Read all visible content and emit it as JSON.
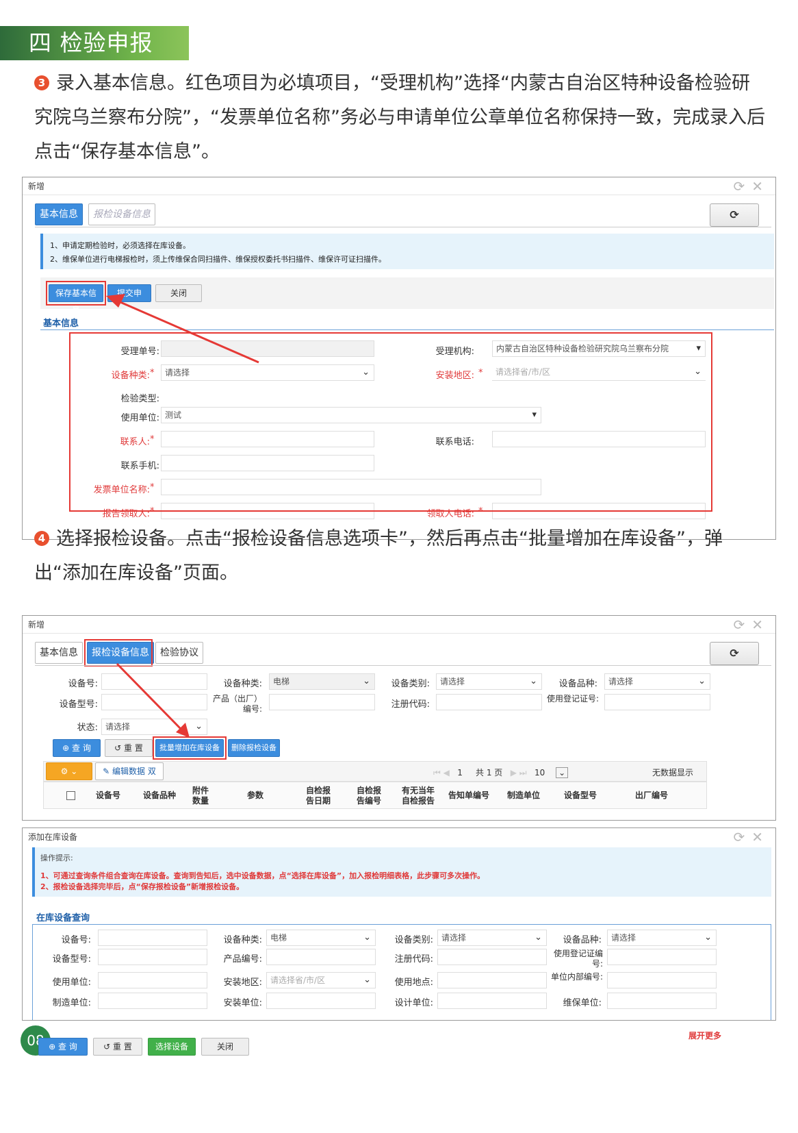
{
  "section": {
    "title": "四 检验申报"
  },
  "step3": {
    "badge": "3",
    "text": "录入基本信息。红色项目为必填项目，“受理机构”选择“内蒙古自治区特种设备检验研究院乌兰察布分院”，“发票单位名称”务必与申请单位公章单位名称保持一致，完成录入后点击“保存基本信息”。"
  },
  "shot1": {
    "window_title": "新增",
    "tabs": [
      "基本信息",
      "报检设备信息"
    ],
    "notices": [
      "1、申请定期检验时，必须选择在库设备。",
      "2、维保单位进行电梯报检时，须上传维保合同扫描件、维保授权委托书扫描件、维保许可证扫描件。"
    ],
    "buttons": [
      "保存基本信息",
      "提交申请",
      "关闭"
    ],
    "section_head": "基本信息",
    "fields": {
      "acceptance_no": "受理单号:",
      "agency": "受理机构:",
      "agency_value": "内蒙古自治区特种设备检验研究院乌兰察布分院",
      "equip_type": "设备种类:",
      "equip_type_value": "请选择",
      "install_area": "安装地区:",
      "install_area_ph": "请选择省/市/区",
      "inspect_type": "检验类型:",
      "user_unit": "使用单位:",
      "user_unit_value": "测试",
      "contact": "联系人:",
      "phone": "联系电话:",
      "mobile": "联系手机:",
      "invoice": "发票单位名称:",
      "report_recv": "报告领取人:",
      "recv_phone": "领取人电话:",
      "req_mark": "*"
    }
  },
  "step4": {
    "badge": "4",
    "text": "选择报检设备。点击“报检设备信息选项卡”，然后再点击“批量增加在库设备”，弹出“添加在库设备”页面。"
  },
  "shot2": {
    "window_title": "新增",
    "tabs": [
      "基本信息",
      "报检设备信息",
      "检验协议"
    ],
    "labels": {
      "equip_no": "设备号:",
      "equip_type": "设备种类:",
      "equip_cat": "设备类别:",
      "equip_var": "设备品种:",
      "model": "设备型号:",
      "product_no": "产品（出厂）编号:",
      "reg_code": "注册代码:",
      "use_reg": "使用登记证号:",
      "status": "状态:"
    },
    "values": {
      "equip_type": "电梯",
      "equip_cat": "请选择",
      "equip_var": "请选择",
      "status": "请选择"
    },
    "buttons": [
      "查 询",
      "重 置",
      "批量增加在库设备",
      "删除报检设备",
      "编辑数据 双击"
    ],
    "pager": {
      "page": "1",
      "total": "共 1 页",
      "size": "10",
      "empty": "无数据显示"
    },
    "columns": [
      "设备号",
      "设备品种",
      "附件数量",
      "参数",
      "自检报告日期",
      "自检报告编号",
      "有无当年自检报告",
      "告知单编号",
      "制造单位",
      "设备型号",
      "出厂编号"
    ]
  },
  "shot3": {
    "window_title": "添加在库设备",
    "tip_head": "操作提示:",
    "tips": [
      "1、可通过查询条件组合查询在库设备。查询到告知后，选中设备数据，点“选择在库设备”，加入报检明细表格，此步骤可多次操作。",
      "2、报检设备选择完毕后，点“保存报检设备”新增报检设备。"
    ],
    "section_head": "在库设备查询",
    "labels": {
      "equip_no": "设备号:",
      "equip_type": "设备种类:",
      "equip_cat": "设备类别:",
      "equip_var": "设备品种:",
      "model": "设备型号:",
      "product_no": "产品编号:",
      "reg_code": "注册代码:",
      "use_reg": "使用登记证编号:",
      "user_unit": "使用单位:",
      "area": "安装地区:",
      "place": "使用地点:",
      "inner_no": "单位内部编号:",
      "maker": "制造单位:",
      "installer": "安装单位:",
      "designer": "设计单位:",
      "maintainer": "维保单位:"
    },
    "values": {
      "equip_type": "电梯",
      "equip_cat": "请选择",
      "equip_var": "请选择",
      "area_ph": "请选择省/市/区"
    },
    "expand": "展开更多",
    "buttons": [
      "查 询",
      "重 置",
      "选择设备",
      "关闭"
    ]
  },
  "page_number": "08",
  "colors": {
    "accent_red": "#e53935",
    "blue": "#3c8dde",
    "green": "#2e8a4a"
  }
}
